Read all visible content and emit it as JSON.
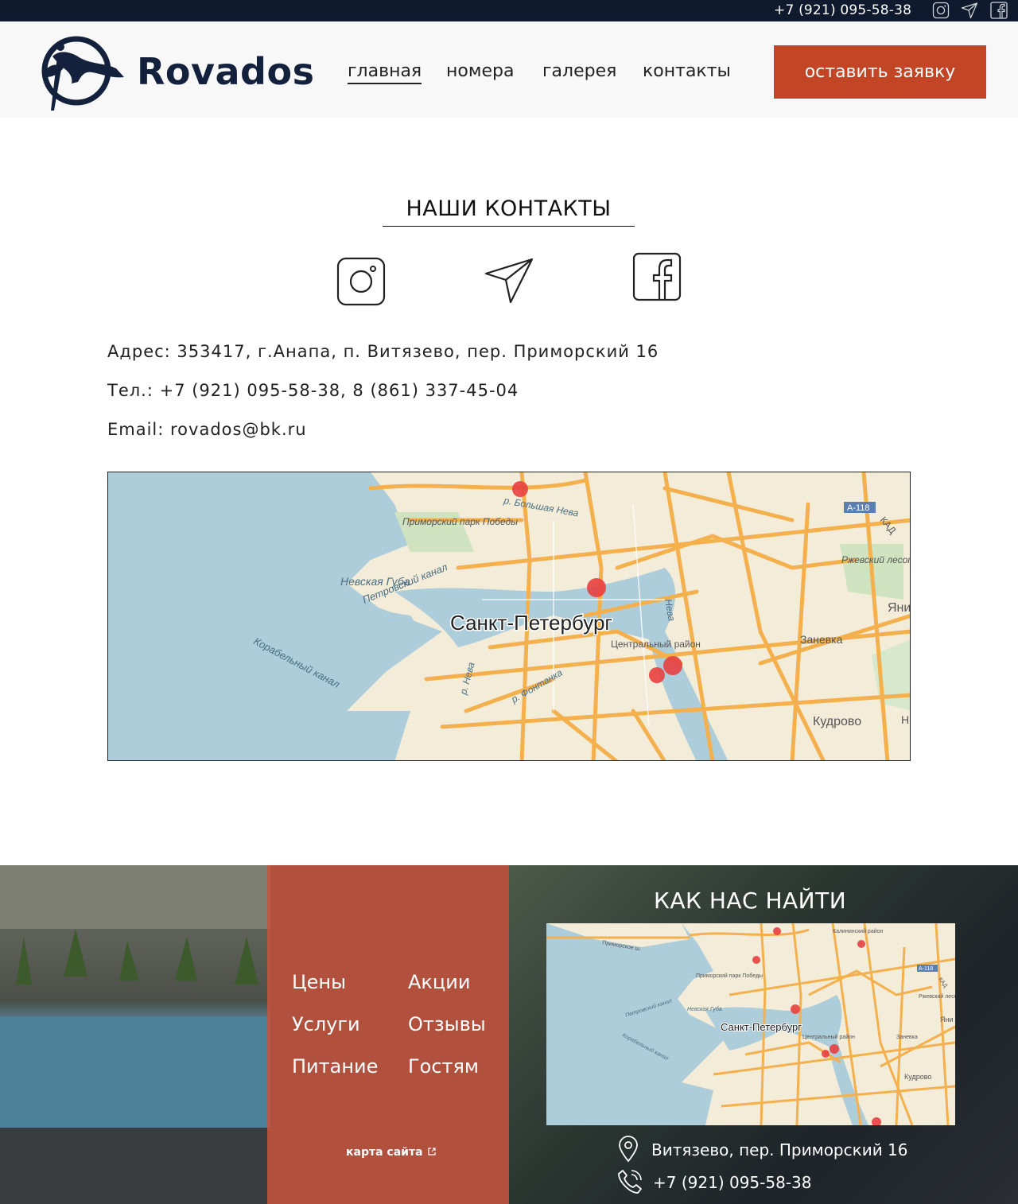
{
  "topbar": {
    "phone": "+7 (921) 095-58-38",
    "icons": [
      "instagram-icon",
      "telegram-icon",
      "facebook-icon"
    ]
  },
  "header": {
    "logo_text": "Rovados",
    "nav": [
      {
        "label": "главная",
        "active": true
      },
      {
        "label": "номера",
        "active": false
      },
      {
        "label": "галерея",
        "active": false
      },
      {
        "label": "контакты",
        "active": false
      }
    ],
    "cta_label": "оставить заявку"
  },
  "contacts": {
    "title": "НАШИ КОНТАКТЫ",
    "social_icons": [
      "instagram-icon",
      "telegram-icon",
      "facebook-icon"
    ],
    "address": "Адрес: 353417, г.Анапа, п. Витязево, пер. Приморский 16",
    "phone": "Тел.: +7 (921) 095-58-38, 8 (861) 337-45-04",
    "email": "Email: rovados@bk.ru"
  },
  "map_main": {
    "city_label": "Санкт-Петербург",
    "labels": {
      "park": "Приморский парк Победы",
      "canal1": "Петровский канал",
      "guba": "Невская Губа",
      "canal2": "Корабельный канал",
      "central": "Центральный район",
      "rzhev": "Ржевский лесопарк",
      "zanevka": "Заневка",
      "kudrovo": "Кудрово",
      "neva1": "р. Большая Нева",
      "neva2": "р. Нева",
      "neva3": "Нева",
      "fontanka": "р. Фонтанка",
      "kad": "КАД",
      "road": "А-118",
      "yani": "Яни",
      "n": "Н"
    }
  },
  "footer": {
    "links": [
      "Цены",
      "Акции",
      "Услуги",
      "Отзывы",
      "Питание",
      "Гостям"
    ],
    "sitemap_label": "карта сайта",
    "find_title": "КАК НАС НАЙТИ",
    "address": "Витязево, пер. Приморский 16",
    "phone": "+7 (921) 095-58-38",
    "map_city_label": "Санкт-Петербург",
    "map_labels": {
      "primorskoe": "Приморское ш.",
      "park": "Приморский парк Победы",
      "guba": "Невская Губа",
      "canal1": "Петровский канал",
      "canal2": "Корабельный канал",
      "central": "Центральный район",
      "rzhev": "Ржевский лесопарк",
      "zanevka": "Заневка",
      "kudrovo": "Кудрово",
      "kalinin": "Калининский район",
      "road": "А-118",
      "kad": "КАД",
      "yani": "Яни"
    }
  },
  "colors": {
    "topbar": "#0f1a2e",
    "accent": "#c24526",
    "logo": "#14213d",
    "footer_panel": "#c4543c",
    "map_water": "#aecdda",
    "map_land": "#f3ecd9",
    "map_road": "#f5b04e",
    "map_marker": "#e84040"
  }
}
